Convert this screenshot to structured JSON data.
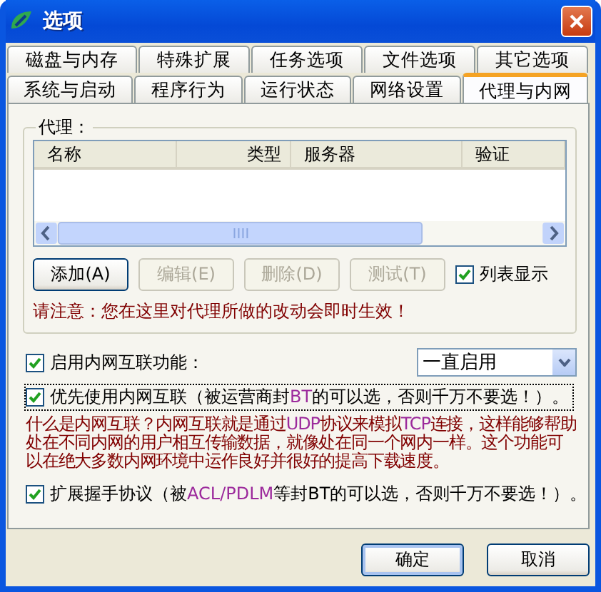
{
  "window": {
    "title": "选项"
  },
  "tab_rows": [
    [
      {
        "label": "磁盘与内存",
        "selected": false
      },
      {
        "label": "特殊扩展",
        "selected": false
      },
      {
        "label": "任务选项",
        "selected": false
      },
      {
        "label": "文件选项",
        "selected": false
      },
      {
        "label": "其它选项",
        "selected": false
      }
    ],
    [
      {
        "label": "系统与启动",
        "selected": false
      },
      {
        "label": "程序行为",
        "selected": false
      },
      {
        "label": "运行状态",
        "selected": false
      },
      {
        "label": "网络设置",
        "selected": false
      },
      {
        "label": "代理与内网",
        "selected": true
      }
    ]
  ],
  "proxy_group": {
    "title": "代理：",
    "columns": [
      "名称",
      "类型",
      "服务器",
      "验证"
    ],
    "buttons": [
      {
        "label": "添加(A)",
        "disabled": false
      },
      {
        "label": "编辑(E)",
        "disabled": true
      },
      {
        "label": "删除(D)",
        "disabled": true
      },
      {
        "label": "测试(T)",
        "disabled": true
      }
    ],
    "list_view": {
      "label": "列表显示",
      "checked": true
    },
    "notice": "请注意：您在这里对代理所做的改动会即时生效！"
  },
  "lan": {
    "enable": {
      "label": "启用内网互联功能：",
      "checked": true
    },
    "mode": {
      "value": "一直启用"
    },
    "prefer": {
      "checked": true,
      "focused": true,
      "segments": [
        {
          "text": "优先使用内网互联（被运营商封",
          "kind": "plain"
        },
        {
          "text": "BT",
          "kind": "accent"
        },
        {
          "text": "的可以选，否则千万不要选！）。",
          "kind": "plain"
        }
      ]
    },
    "description": [
      {
        "text": "什么是内网互联？内网互联就是通过",
        "kind": "plain"
      },
      {
        "text": "UDP",
        "kind": "accent"
      },
      {
        "text": "协议来模拟",
        "kind": "plain"
      },
      {
        "text": "TCP",
        "kind": "accent"
      },
      {
        "text": "连接，这样能够帮助处在不同内网的用户相互传输数据，就像处在同一个网内一样。这个功能可以在绝大多数内网环境中运作良好并很好的提高下载速度。",
        "kind": "plain"
      }
    ],
    "handshake": {
      "checked": true,
      "focused": false,
      "segments": [
        {
          "text": "扩展握手协议（被",
          "kind": "plain"
        },
        {
          "text": "ACL/PDLM",
          "kind": "accent"
        },
        {
          "text": "等封BT的可以选，否则千万不要选！）。",
          "kind": "plain"
        }
      ]
    }
  },
  "footer_buttons": [
    {
      "label": "确定",
      "default": true
    },
    {
      "label": "取消",
      "default": false
    }
  ]
}
